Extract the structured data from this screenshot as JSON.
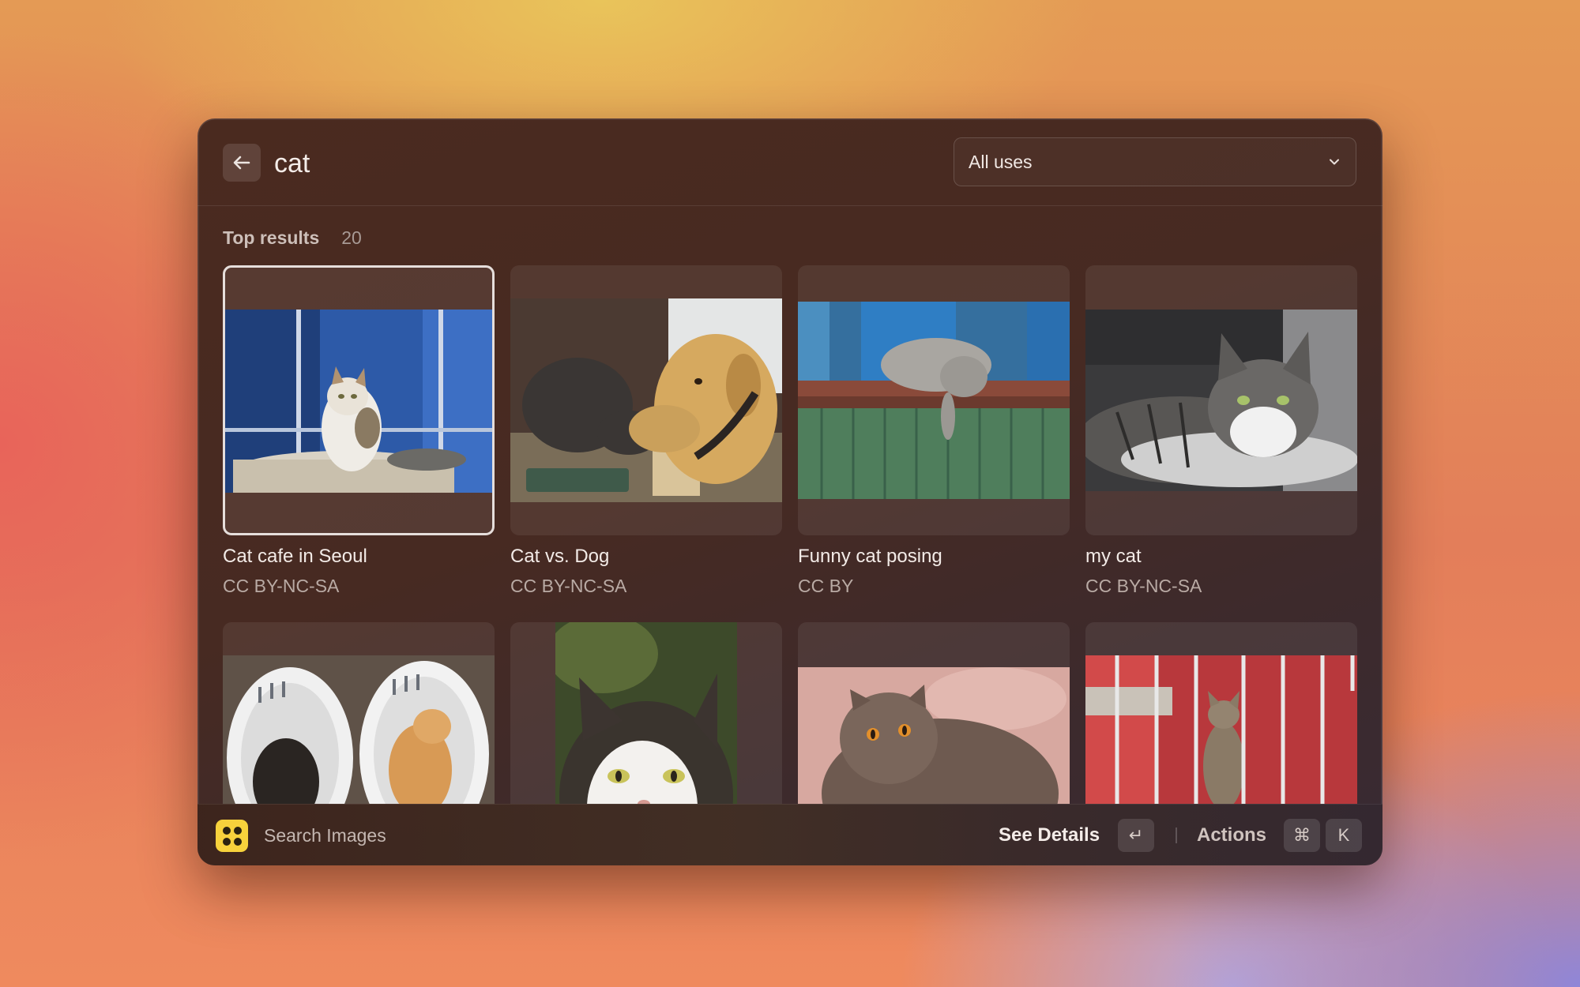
{
  "search": {
    "query": "cat"
  },
  "filter": {
    "selected": "All uses",
    "chevron_icon": "chevron-down-icon"
  },
  "results": {
    "section_title": "Top results",
    "count": "20",
    "items": [
      {
        "title": "Cat cafe in Seoul",
        "license": "CC BY-NC-SA",
        "selected": true
      },
      {
        "title": "Cat vs. Dog",
        "license": "CC BY-NC-SA",
        "selected": false
      },
      {
        "title": "Funny cat posing",
        "license": "CC BY",
        "selected": false
      },
      {
        "title": "my cat",
        "license": "CC BY-NC-SA",
        "selected": false
      }
    ]
  },
  "footer": {
    "app_title": "Search Images",
    "primary_action": "See Details",
    "primary_shortcut": "↵",
    "actions_label": "Actions",
    "actions_shortcut_mod": "⌘",
    "actions_shortcut_key": "K"
  },
  "colors": {
    "app_icon": "#f7d23c",
    "window_bg": "#4a2a1f",
    "selection_border": "#e6dedb"
  }
}
